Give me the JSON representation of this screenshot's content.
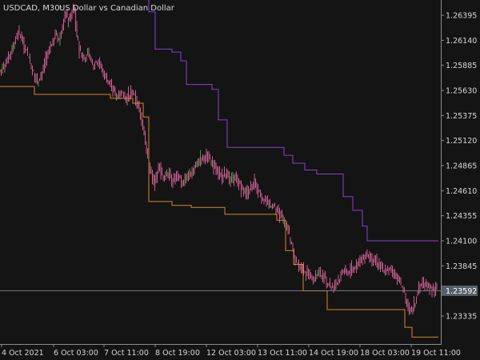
{
  "header": {
    "symbol_tf": "USDCAD, M30:",
    "description": "US Dollar vs Canadian Dollar"
  },
  "colors": {
    "background": "#141414",
    "axis": "#8c8c8c",
    "text": "#d6d6d6",
    "candle_up": "#3fa63f",
    "candle_down": "#c95c8e",
    "lower_line": "#d9832a",
    "upper_line": "#8a3fd0",
    "price_line": "#7a7a7a",
    "price_label_bg": "#55606b",
    "price_label_text": "#ffffff"
  },
  "chart_data": {
    "type": "line",
    "ylim": [
      1.2305,
      1.2655
    ],
    "y_ticks": [
      "1.26395",
      "1.26140",
      "1.25885",
      "1.25630",
      "1.25375",
      "1.25120",
      "1.24865",
      "1.24610",
      "1.24355",
      "1.24100",
      "1.23845",
      "1.23590",
      "1.23335"
    ],
    "x_ticks": [
      "4 Oct 2021",
      "6 Oct 03:00",
      "7 Oct 11:00",
      "8 Oct 19:00",
      "12 Oct 03:00",
      "13 Oct 11:00",
      "14 Oct 19:00",
      "18 Oct 03:00",
      "19 Oct 11:00"
    ],
    "current_price": 1.23592,
    "current_price_label": "1.23592",
    "price_path": [
      [
        0,
        1.2583
      ],
      [
        8,
        1.2592
      ],
      [
        16,
        1.2608
      ],
      [
        22,
        1.2623
      ],
      [
        28,
        1.2614
      ],
      [
        34,
        1.2599
      ],
      [
        40,
        1.2585
      ],
      [
        46,
        1.2572
      ],
      [
        52,
        1.258
      ],
      [
        58,
        1.2596
      ],
      [
        64,
        1.261
      ],
      [
        70,
        1.2621
      ],
      [
        74,
        1.2613
      ],
      [
        78,
        1.2628
      ],
      [
        82,
        1.2641
      ],
      [
        86,
        1.2633
      ],
      [
        92,
        1.2649
      ],
      [
        96,
        1.2618
      ],
      [
        100,
        1.2601
      ],
      [
        105,
        1.2594
      ],
      [
        110,
        1.26
      ],
      [
        116,
        1.2589
      ],
      [
        122,
        1.2595
      ],
      [
        128,
        1.2582
      ],
      [
        134,
        1.2574
      ],
      [
        140,
        1.2566
      ],
      [
        146,
        1.2556
      ],
      [
        152,
        1.256
      ],
      [
        158,
        1.2555
      ],
      [
        164,
        1.2562
      ],
      [
        170,
        1.2553
      ],
      [
        175,
        1.254
      ],
      [
        180,
        1.2522
      ],
      [
        184,
        1.2495
      ],
      [
        188,
        1.2482
      ],
      [
        192,
        1.2466
      ],
      [
        198,
        1.2487
      ],
      [
        204,
        1.2474
      ],
      [
        210,
        1.248
      ],
      [
        216,
        1.2471
      ],
      [
        222,
        1.2476
      ],
      [
        228,
        1.2468
      ],
      [
        234,
        1.2475
      ],
      [
        240,
        1.248
      ],
      [
        246,
        1.2489
      ],
      [
        252,
        1.2493
      ],
      [
        258,
        1.2497
      ],
      [
        264,
        1.249
      ],
      [
        270,
        1.2483
      ],
      [
        276,
        1.2475
      ],
      [
        282,
        1.248
      ],
      [
        288,
        1.2469
      ],
      [
        294,
        1.2474
      ],
      [
        300,
        1.2466
      ],
      [
        306,
        1.2458
      ],
      [
        312,
        1.2462
      ],
      [
        318,
        1.2469
      ],
      [
        324,
        1.2459
      ],
      [
        330,
        1.2451
      ],
      [
        336,
        1.2447
      ],
      [
        342,
        1.2443
      ],
      [
        348,
        1.244
      ],
      [
        354,
        1.243
      ],
      [
        360,
        1.2419
      ],
      [
        364,
        1.2406
      ],
      [
        368,
        1.2391
      ],
      [
        374,
        1.2385
      ],
      [
        380,
        1.2379
      ],
      [
        386,
        1.2376
      ],
      [
        392,
        1.2371
      ],
      [
        398,
        1.2377
      ],
      [
        404,
        1.2373
      ],
      [
        410,
        1.2366
      ],
      [
        416,
        1.2362
      ],
      [
        422,
        1.2369
      ],
      [
        428,
        1.238
      ],
      [
        434,
        1.2377
      ],
      [
        440,
        1.2382
      ],
      [
        446,
        1.2387
      ],
      [
        452,
        1.2391
      ],
      [
        458,
        1.2398
      ],
      [
        464,
        1.2394
      ],
      [
        470,
        1.2389
      ],
      [
        476,
        1.2384
      ],
      [
        482,
        1.2378
      ],
      [
        488,
        1.2382
      ],
      [
        494,
        1.2375
      ],
      [
        500,
        1.2367
      ],
      [
        504,
        1.2359
      ],
      [
        508,
        1.2346
      ],
      [
        512,
        1.2335
      ],
      [
        516,
        1.2341
      ],
      [
        520,
        1.2352
      ],
      [
        524,
        1.2363
      ],
      [
        528,
        1.2369
      ],
      [
        534,
        1.2364
      ],
      [
        540,
        1.2361
      ],
      [
        546,
        1.2359
      ]
    ],
    "series": [
      {
        "name": "",
        "color": "#d9832a",
        "points": [
          [
            0,
            1.2567
          ],
          [
            42,
            1.2567
          ],
          [
            43,
            1.2559
          ],
          [
            137,
            1.2559
          ],
          [
            138,
            1.2555
          ],
          [
            165,
            1.2555
          ],
          [
            166,
            1.255
          ],
          [
            178,
            1.255
          ],
          [
            179,
            1.2536
          ],
          [
            185,
            1.2536
          ],
          [
            186,
            1.245
          ],
          [
            214,
            1.245
          ],
          [
            215,
            1.2446
          ],
          [
            238,
            1.2446
          ],
          [
            239,
            1.2444
          ],
          [
            280,
            1.2444
          ],
          [
            281,
            1.2437
          ],
          [
            345,
            1.2437
          ],
          [
            346,
            1.2431
          ],
          [
            356,
            1.2431
          ],
          [
            357,
            1.24
          ],
          [
            366,
            1.24
          ],
          [
            367,
            1.2386
          ],
          [
            378,
            1.2386
          ],
          [
            379,
            1.2359
          ],
          [
            408,
            1.2359
          ],
          [
            409,
            1.234
          ],
          [
            505,
            1.234
          ],
          [
            506,
            1.2322
          ],
          [
            514,
            1.2322
          ],
          [
            515,
            1.2312
          ],
          [
            548,
            1.2312
          ]
        ]
      },
      {
        "name": "",
        "color": "#8a3fd0",
        "points": [
          [
            185,
            1.2655
          ],
          [
            186,
            1.2643
          ],
          [
            193,
            1.2643
          ],
          [
            194,
            1.2605
          ],
          [
            214,
            1.2605
          ],
          [
            215,
            1.2602
          ],
          [
            225,
            1.2602
          ],
          [
            226,
            1.2593
          ],
          [
            232,
            1.2593
          ],
          [
            233,
            1.2569
          ],
          [
            264,
            1.2569
          ],
          [
            265,
            1.2564
          ],
          [
            272,
            1.2564
          ],
          [
            273,
            1.2533
          ],
          [
            283,
            1.2533
          ],
          [
            284,
            1.2505
          ],
          [
            354,
            1.2505
          ],
          [
            355,
            1.2497
          ],
          [
            365,
            1.2497
          ],
          [
            366,
            1.2489
          ],
          [
            380,
            1.2489
          ],
          [
            381,
            1.2482
          ],
          [
            395,
            1.2482
          ],
          [
            396,
            1.2478
          ],
          [
            428,
            1.2478
          ],
          [
            429,
            1.2455
          ],
          [
            440,
            1.2455
          ],
          [
            441,
            1.2441
          ],
          [
            452,
            1.2441
          ],
          [
            453,
            1.2425
          ],
          [
            458,
            1.2425
          ],
          [
            459,
            1.241
          ],
          [
            548,
            1.241
          ]
        ]
      }
    ]
  }
}
